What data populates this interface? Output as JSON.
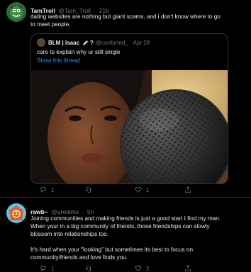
{
  "tweet1": {
    "name": "TamTroll",
    "handle": "@Tam_Troll",
    "time": "21h",
    "text_line1": "dating websites are nothing but giant scams, and i don't know where to go",
    "text_line2": "to meet people.",
    "quote": {
      "name": "BLM | Isaac",
      "name_suffix": "?",
      "handle": "@confurted_",
      "time": "Apr 28",
      "text": "care to explain why ur still single",
      "show_thread": "Show this thread"
    },
    "replies": "1",
    "retweets": "",
    "likes": "1"
  },
  "tweet2": {
    "name": "rawb~",
    "handle": "@urealms",
    "time": "5h",
    "line1": "Joining communities and making friends is just a good start I find my man.",
    "line2": "When your in a big community of friends, those friendships can slowly",
    "line3": "blossom into relationships too.",
    "line4": "It's hard when your \"looking\" but sometimes its best to focus on",
    "line5": "community/friends and love finds you.",
    "replies": "1",
    "retweets": "",
    "likes": "2"
  },
  "colors": {
    "background": "#000000",
    "text": "#e7e9ea",
    "muted": "#71767b",
    "link": "#1d9bf0",
    "border": "#2f3336"
  }
}
